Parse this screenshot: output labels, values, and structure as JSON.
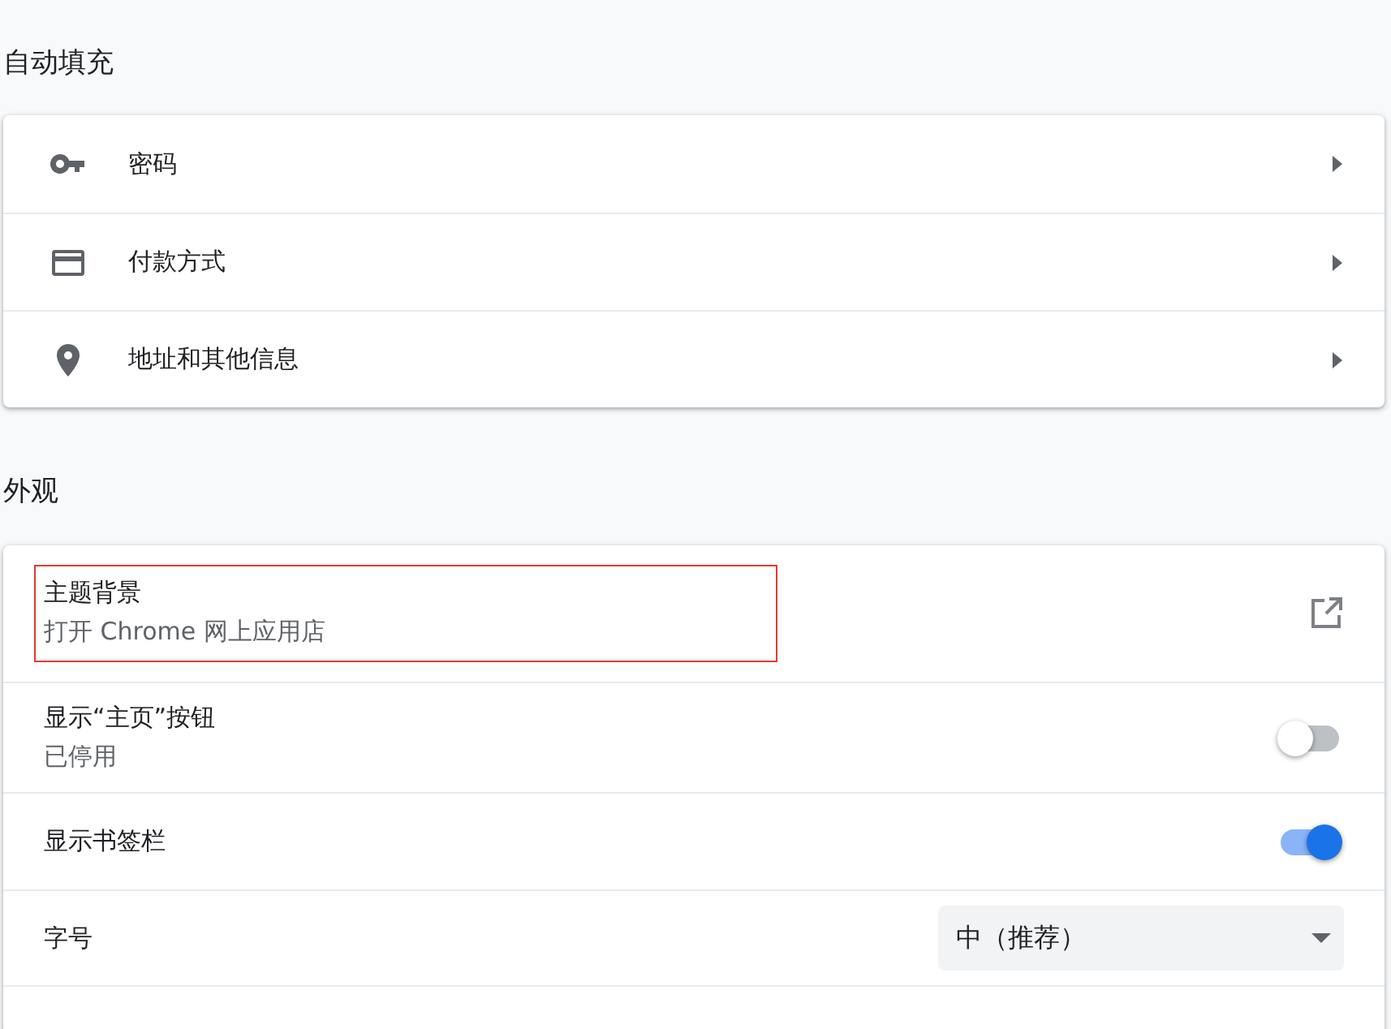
{
  "sections": [
    {
      "title": "自动填充",
      "rows": [
        {
          "kind": "link",
          "label": "密码"
        },
        {
          "kind": "link",
          "label": "付款方式"
        },
        {
          "kind": "link",
          "label": "地址和其他信息"
        }
      ]
    },
    {
      "title": "外观",
      "rows": [
        {
          "kind": "external",
          "label": "主题背景",
          "sublabel": "打开 Chrome 网上应用店",
          "annotated": true
        },
        {
          "kind": "toggle",
          "label": "显示“主页”按钮",
          "sublabel": "已停用",
          "on": false
        },
        {
          "kind": "toggle",
          "label": "显示书签栏",
          "on": true
        },
        {
          "kind": "select",
          "label": "字号",
          "value": "中（推荐）"
        }
      ]
    }
  ]
}
